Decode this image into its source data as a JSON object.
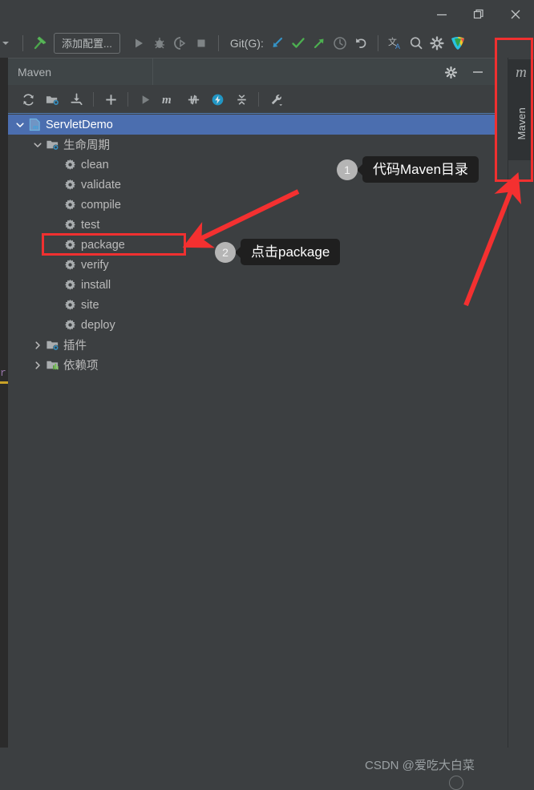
{
  "window": {
    "buttons": [
      {
        "name": "minimize-button",
        "glyph": "minimize-icon"
      },
      {
        "name": "restore-button",
        "glyph": "restore-icon"
      },
      {
        "name": "close-button",
        "glyph": "close-icon"
      }
    ]
  },
  "toolbar": {
    "run_config_label": "添加配置...",
    "git_label": "Git(G):",
    "icons": [
      {
        "name": "history-dropdown-icon",
        "title": ""
      },
      {
        "name": "build-hammer-icon",
        "title": ""
      },
      {
        "name": "run-icon",
        "title": ""
      },
      {
        "name": "debug-icon",
        "title": ""
      },
      {
        "name": "run-coverage-icon",
        "title": ""
      },
      {
        "name": "stop-icon",
        "title": ""
      },
      {
        "name": "git-update-icon",
        "title": ""
      },
      {
        "name": "git-commit-icon",
        "title": ""
      },
      {
        "name": "git-push-icon",
        "title": ""
      },
      {
        "name": "git-history-icon",
        "title": ""
      },
      {
        "name": "git-rollback-icon",
        "title": ""
      },
      {
        "name": "translate-icon",
        "title": ""
      },
      {
        "name": "search-icon",
        "title": ""
      },
      {
        "name": "settings-gear-icon",
        "title": ""
      },
      {
        "name": "ide-logo-icon",
        "title": ""
      }
    ]
  },
  "maven_panel": {
    "title": "Maven",
    "header_icons": [
      {
        "name": "maven-settings-gear-icon"
      },
      {
        "name": "hide-panel-icon"
      }
    ],
    "toolbar_icons": [
      {
        "name": "reload-projects-icon"
      },
      {
        "name": "generate-sources-icon"
      },
      {
        "name": "download-sources-icon"
      },
      {
        "name": "add-maven-project-icon"
      },
      {
        "name": "run-maven-build-icon"
      },
      {
        "name": "execute-maven-goal-icon"
      },
      {
        "name": "toggle-skip-tests-icon"
      },
      {
        "name": "toggle-offline-mode-icon"
      },
      {
        "name": "collapse-all-icon"
      },
      {
        "name": "maven-settings-wrench-icon"
      }
    ],
    "tree": [
      {
        "label": "ServletDemo",
        "indent": 0,
        "chevron": "down",
        "icon": "maven-project-icon",
        "selected": true
      },
      {
        "label": "生命周期",
        "indent": 1,
        "chevron": "down",
        "icon": "lifecycle-folder-icon",
        "selected": false
      },
      {
        "label": "clean",
        "indent": 2,
        "chevron": "none",
        "icon": "maven-goal-gear-icon",
        "selected": false
      },
      {
        "label": "validate",
        "indent": 2,
        "chevron": "none",
        "icon": "maven-goal-gear-icon",
        "selected": false
      },
      {
        "label": "compile",
        "indent": 2,
        "chevron": "none",
        "icon": "maven-goal-gear-icon",
        "selected": false
      },
      {
        "label": "test",
        "indent": 2,
        "chevron": "none",
        "icon": "maven-goal-gear-icon",
        "selected": false
      },
      {
        "label": "package",
        "indent": 2,
        "chevron": "none",
        "icon": "maven-goal-gear-icon",
        "selected": false
      },
      {
        "label": "verify",
        "indent": 2,
        "chevron": "none",
        "icon": "maven-goal-gear-icon",
        "selected": false
      },
      {
        "label": "install",
        "indent": 2,
        "chevron": "none",
        "icon": "maven-goal-gear-icon",
        "selected": false
      },
      {
        "label": "site",
        "indent": 2,
        "chevron": "none",
        "icon": "maven-goal-gear-icon",
        "selected": false
      },
      {
        "label": "deploy",
        "indent": 2,
        "chevron": "none",
        "icon": "maven-goal-gear-icon",
        "selected": false
      },
      {
        "label": "插件",
        "indent": 1,
        "chevron": "right",
        "icon": "plugins-folder-icon",
        "selected": false
      },
      {
        "label": "依赖项",
        "indent": 1,
        "chevron": "right",
        "icon": "dependencies-folder-icon",
        "selected": false
      }
    ]
  },
  "right_stripe": {
    "m_glyph": "m",
    "tab_label": "Maven"
  },
  "annotations": {
    "highlight_color": "#f03030",
    "callouts": [
      {
        "number": "1",
        "text": "代码Maven目录"
      },
      {
        "number": "2",
        "text": "点击package"
      }
    ]
  },
  "watermark": {
    "text": "CSDN @爱吃大白菜"
  }
}
